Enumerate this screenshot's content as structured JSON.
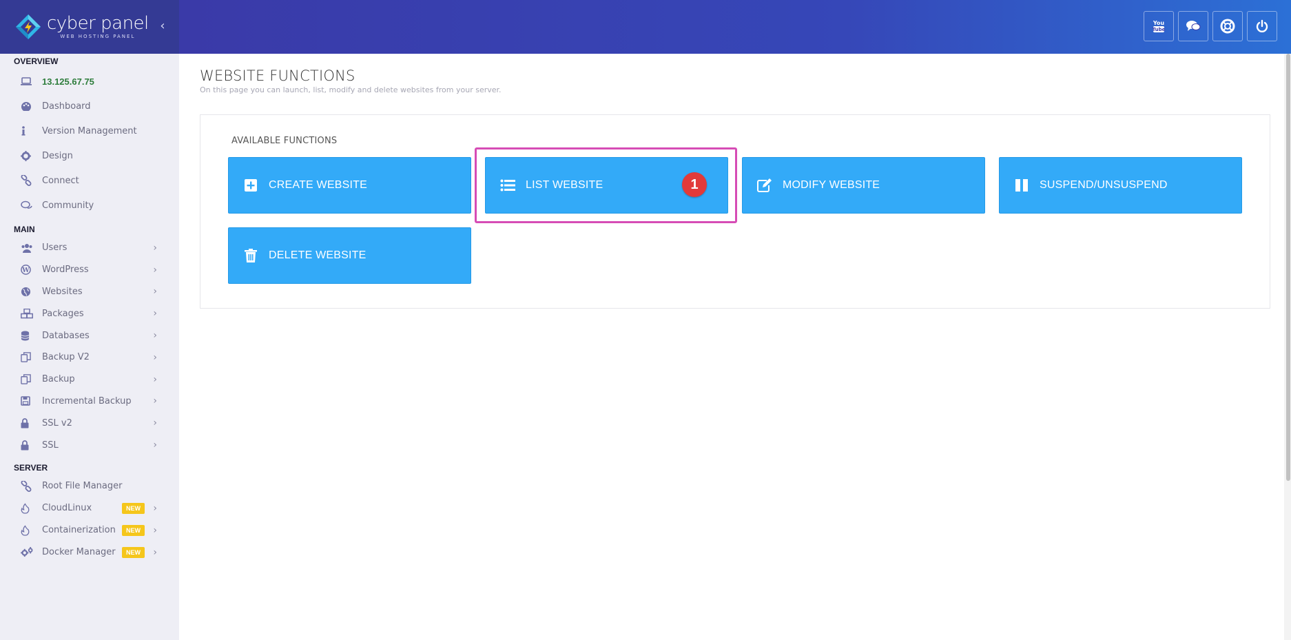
{
  "logo": {
    "brand": "cyber panel",
    "tagline": "WEB HOSTING PANEL"
  },
  "sidebar": {
    "sections": [
      {
        "title": "OVERVIEW",
        "items": [
          {
            "label": "13.125.67.75",
            "icon": "laptop-icon",
            "chevron": false,
            "new": false
          },
          {
            "label": "Dashboard",
            "icon": "palette-icon",
            "chevron": false,
            "new": false
          },
          {
            "label": "Version Management",
            "icon": "info-icon",
            "chevron": false,
            "new": false
          },
          {
            "label": "Design",
            "icon": "gear-icon",
            "chevron": false,
            "new": false
          },
          {
            "label": "Connect",
            "icon": "link-icon",
            "chevron": false,
            "new": false
          },
          {
            "label": "Community",
            "icon": "comments-icon",
            "chevron": false,
            "new": false
          }
        ]
      },
      {
        "title": "MAIN",
        "items": [
          {
            "label": "Users",
            "icon": "users-icon",
            "chevron": true,
            "new": false
          },
          {
            "label": "WordPress",
            "icon": "wordpress-icon",
            "chevron": true,
            "new": false
          },
          {
            "label": "Websites",
            "icon": "globe-icon",
            "chevron": true,
            "new": false
          },
          {
            "label": "Packages",
            "icon": "cubes-icon",
            "chevron": true,
            "new": false
          },
          {
            "label": "Databases",
            "icon": "database-icon",
            "chevron": true,
            "new": false
          },
          {
            "label": "Backup V2",
            "icon": "copy-icon",
            "chevron": true,
            "new": false
          },
          {
            "label": "Backup",
            "icon": "copy-icon",
            "chevron": true,
            "new": false
          },
          {
            "label": "Incremental Backup",
            "icon": "save-icon",
            "chevron": true,
            "new": false
          },
          {
            "label": "SSL v2",
            "icon": "lock-icon",
            "chevron": true,
            "new": false
          },
          {
            "label": "SSL",
            "icon": "lock-icon",
            "chevron": true,
            "new": false
          }
        ]
      },
      {
        "title": "SERVER",
        "items": [
          {
            "label": "Root File Manager",
            "icon": "link-icon",
            "chevron": false,
            "new": false
          },
          {
            "label": "CloudLinux",
            "icon": "fire-icon",
            "chevron": true,
            "new": true
          },
          {
            "label": "Containerization",
            "icon": "fire-icon",
            "chevron": true,
            "new": true
          },
          {
            "label": "Docker Manager",
            "icon": "gears-icon",
            "chevron": true,
            "new": true
          }
        ]
      }
    ],
    "new_badge": "NEW"
  },
  "topbar": {
    "buttons": [
      {
        "name": "youtube-button",
        "icon": "youtube-icon"
      },
      {
        "name": "chat-button",
        "icon": "comments-icon"
      },
      {
        "name": "support-button",
        "icon": "life-ring-icon"
      },
      {
        "name": "logout-button",
        "icon": "power-icon"
      }
    ]
  },
  "page": {
    "title": "WEBSITE FUNCTIONS",
    "subtitle": "On this page you can launch, list, modify and delete websites from your server."
  },
  "panel": {
    "title": "AVAILABLE FUNCTIONS",
    "buttons": [
      {
        "label": "CREATE WEBSITE",
        "icon": "plus-square-icon"
      },
      {
        "label": "LIST WEBSITE",
        "icon": "list-icon"
      },
      {
        "label": "MODIFY WEBSITE",
        "icon": "edit-icon"
      },
      {
        "label": "SUSPEND/UNSUSPEND",
        "icon": "pause-icon"
      },
      {
        "label": "DELETE WEBSITE",
        "icon": "trash-icon"
      }
    ]
  },
  "annotation": {
    "step": "1"
  },
  "colors": {
    "accent": "#33aaf8",
    "topbar": "#3a3aa8",
    "highlight": "#d64cb5",
    "badge": "#e23a3a",
    "new": "#f5c61b"
  }
}
